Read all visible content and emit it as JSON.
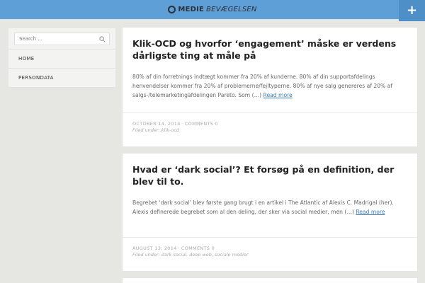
{
  "header": {
    "logo_bold": "MEDIE",
    "logo_light": "BEVÆGELSEN",
    "plus_label": "+"
  },
  "sidebar": {
    "search_placeholder": "Search ...",
    "items": [
      {
        "label": "HOME"
      },
      {
        "label": "PERSONDATA"
      }
    ]
  },
  "posts": [
    {
      "title": "Klik-OCD og hvorfor ‘engagement’ måske er verdens dårligste ting at måle på",
      "excerpt": "80% af din forretnings indtægt kommer fra 20% af kunderne. 80% af din supportafdelings henvendelser kommer fra 20% af problemerne/fejltyperne. 80% af nye salg genereres af 20% af salgs-/telemarketingafdelingen Pareto. Som (…)",
      "read_more": "Read more",
      "date": "October 14, 2014",
      "sep": " · ",
      "comments": "Comments 0",
      "filed_under": "Filed under:",
      "tags": "klik-ocd"
    },
    {
      "title": "Hvad er ‘dark social’? Et forsøg på en definition, der blev til to.",
      "excerpt": "Begrebet ‘dark social’ blev første gang brugt i en artikel i The Atlantic af Alexis C. Madrigal (her). Alexis definerede begrebet som al den deling, der sker via social medier, men (…)",
      "read_more": "Read more",
      "date": "August 13, 2014",
      "sep": " · ",
      "comments": "Comments 0",
      "filed_under": "Filed under:",
      "tags": "dark social, deep web, sociale medier"
    }
  ]
}
